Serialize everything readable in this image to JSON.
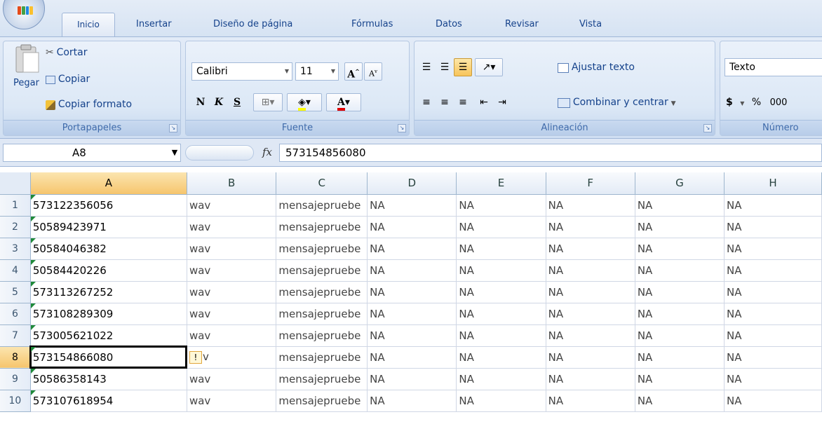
{
  "tabs": [
    "Inicio",
    "Insertar",
    "Diseño de página",
    "Fórmulas",
    "Datos",
    "Revisar",
    "Vista"
  ],
  "clipboard": {
    "paste": "Pegar",
    "cut": "Cortar",
    "copy": "Copiar",
    "format_painter": "Copiar formato",
    "title": "Portapapeles"
  },
  "font": {
    "name": "Calibri",
    "size": "11",
    "bold": "N",
    "italic": "K",
    "underline": "S",
    "title": "Fuente"
  },
  "alignment": {
    "wrap_text": "Ajustar texto",
    "merge_center": "Combinar y centrar",
    "title": "Alineación"
  },
  "number": {
    "format": "Texto",
    "currency": "$",
    "percent": "%",
    "thousands": "000",
    "title": "Número"
  },
  "formula_bar": {
    "name_box": "A8",
    "fx": "fx",
    "formula": "573154856080"
  },
  "columns": [
    "A",
    "B",
    "C",
    "D",
    "E",
    "F",
    "G",
    "H"
  ],
  "rows": [
    {
      "n": "1",
      "a": "573122356056",
      "b": "wav",
      "c": "mensajepruebe",
      "d": "NA",
      "e": "NA",
      "f": "NA",
      "g": "NA",
      "h": "NA"
    },
    {
      "n": "2",
      "a": "50589423971",
      "b": "wav",
      "c": "mensajepruebe",
      "d": "NA",
      "e": "NA",
      "f": "NA",
      "g": "NA",
      "h": "NA"
    },
    {
      "n": "3",
      "a": "50584046382",
      "b": "wav",
      "c": "mensajepruebe",
      "d": "NA",
      "e": "NA",
      "f": "NA",
      "g": "NA",
      "h": "NA"
    },
    {
      "n": "4",
      "a": "50584420226",
      "b": "wav",
      "c": "mensajepruebe",
      "d": "NA",
      "e": "NA",
      "f": "NA",
      "g": "NA",
      "h": "NA"
    },
    {
      "n": "5",
      "a": "573113267252",
      "b": "wav",
      "c": "mensajepruebe",
      "d": "NA",
      "e": "NA",
      "f": "NA",
      "g": "NA",
      "h": "NA"
    },
    {
      "n": "6",
      "a": "573108289309",
      "b": "wav",
      "c": "mensajepruebe",
      "d": "NA",
      "e": "NA",
      "f": "NA",
      "g": "NA",
      "h": "NA"
    },
    {
      "n": "7",
      "a": "573005621022",
      "b": "wav",
      "c": "mensajepruebe",
      "d": "NA",
      "e": "NA",
      "f": "NA",
      "g": "NA",
      "h": "NA"
    },
    {
      "n": "8",
      "a": "573154866080",
      "b": "v",
      "c": "mensajepruebe",
      "d": "NA",
      "e": "NA",
      "f": "NA",
      "g": "NA",
      "h": "NA"
    },
    {
      "n": "9",
      "a": "50586358143",
      "b": "wav",
      "c": "mensajepruebe",
      "d": "NA",
      "e": "NA",
      "f": "NA",
      "g": "NA",
      "h": "NA"
    },
    {
      "n": "10",
      "a": "573107618954",
      "b": "wav",
      "c": "mensajepruebe",
      "d": "NA",
      "e": "NA",
      "f": "NA",
      "g": "NA",
      "h": "NA"
    }
  ],
  "colors": {
    "accent": "#15428b",
    "selected_header": "#f6c56d",
    "error_indicator": "#1f8a3a"
  }
}
